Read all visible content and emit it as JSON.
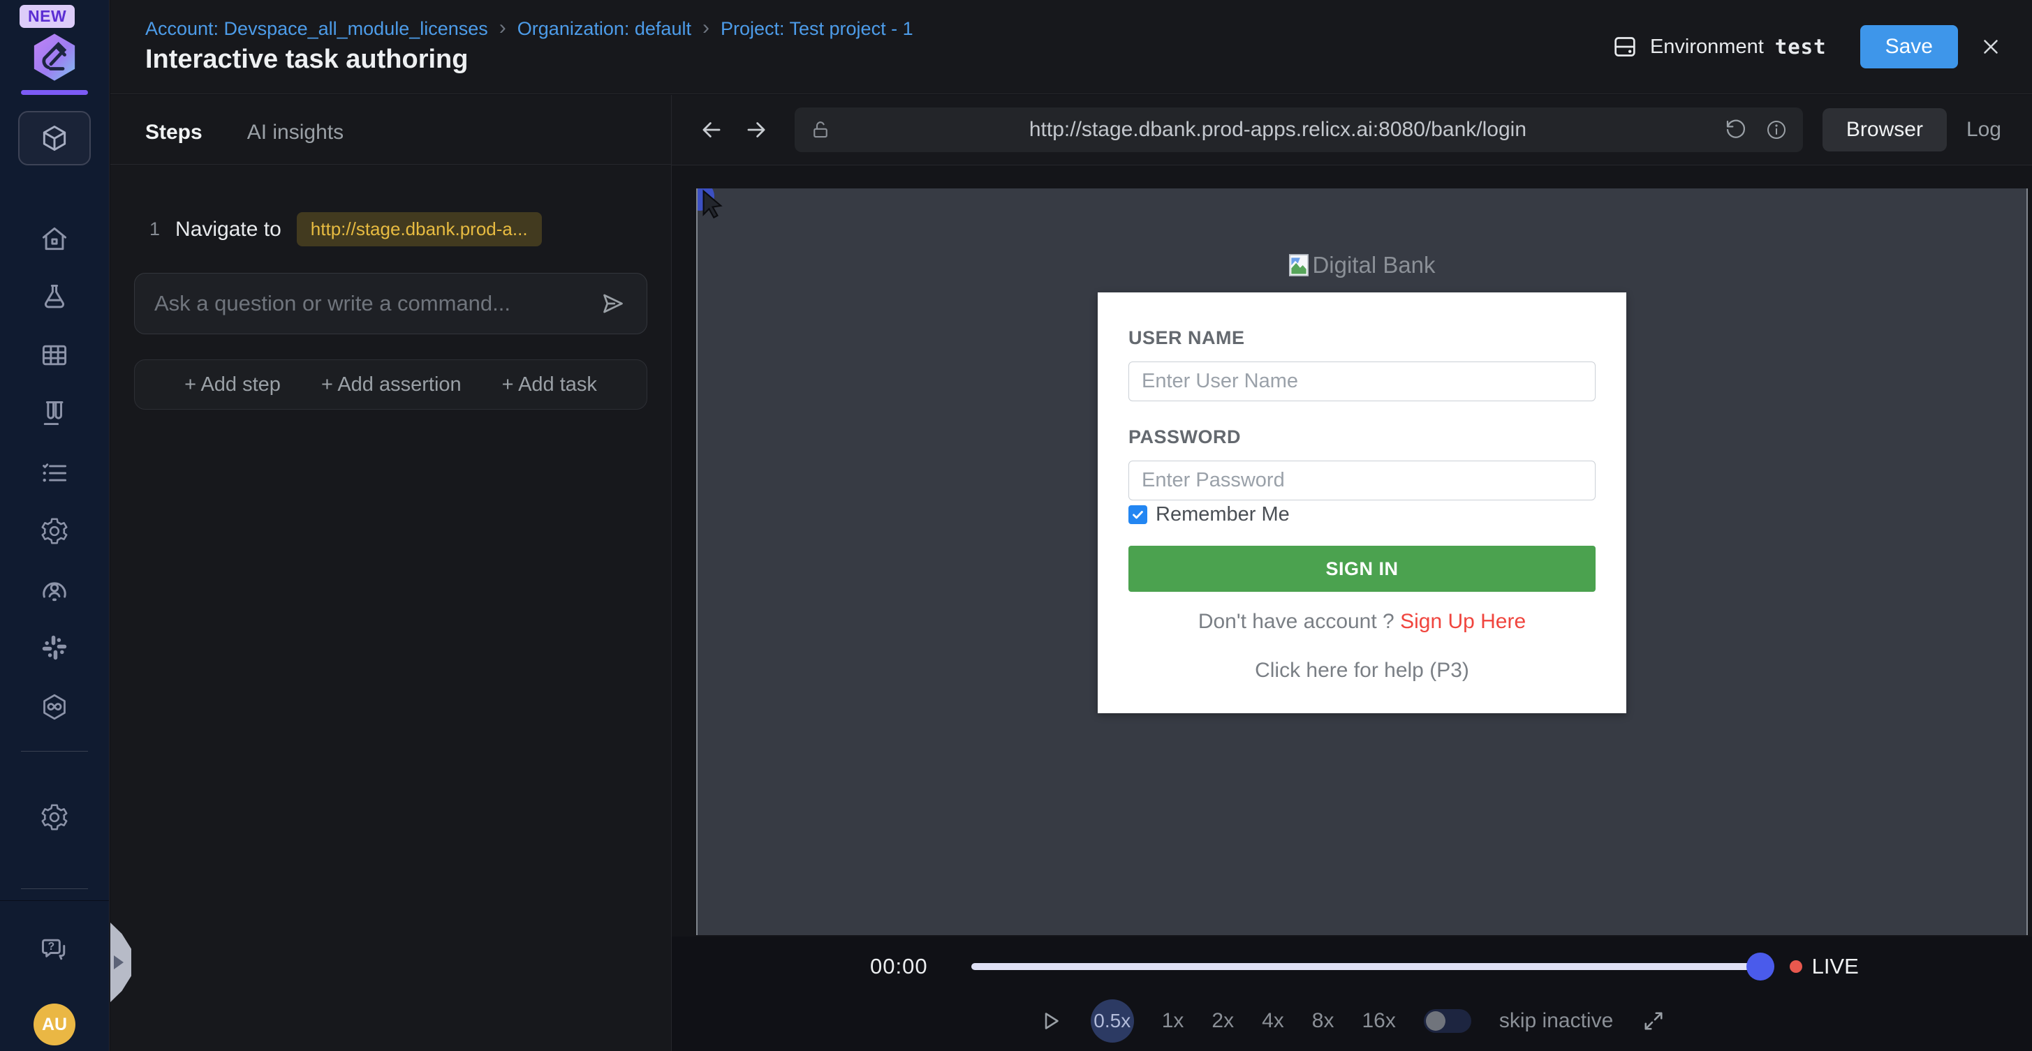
{
  "colors": {
    "accent_blue": "#3e96ea",
    "brand_purple": "#7c5bf5",
    "breadcrumb_link": "#4d9ce9",
    "step_target_yellow": "#e7bb41",
    "signin_green": "#4ba24f",
    "signup_red": "#f0453e",
    "live_red": "#e8584e",
    "player_thumb_blue": "#4a5beb",
    "avatar_gold": "#eab744"
  },
  "badge_new": "NEW",
  "breadcrumb": {
    "separator": "›",
    "items": [
      {
        "label": "Account: Devspace_all_module_licenses"
      },
      {
        "label": "Organization: default"
      },
      {
        "label": "Project: Test project - 1"
      }
    ]
  },
  "header": {
    "title": "Interactive task authoring",
    "environment_label": "Environment",
    "environment_value": "test",
    "save_label": "Save"
  },
  "sidebar": {
    "icons": [
      "package-icon",
      "home-icon",
      "flask-icon",
      "grid-icon",
      "test-tubes-icon",
      "checklist-icon",
      "gear-icon",
      "user-search-icon",
      "slack-icon",
      "hexagon-link-icon",
      "settings-icon",
      "help-chat-icon"
    ],
    "avatar_initials": "AU"
  },
  "steps_panel": {
    "tabs": [
      {
        "label": "Steps",
        "active": true
      },
      {
        "label": "AI insights",
        "active": false
      }
    ],
    "step": {
      "number": "1",
      "action": "Navigate to",
      "target": "http://stage.dbank.prod-a..."
    },
    "command_placeholder": "Ask a question or write a command...",
    "actions": [
      {
        "label": "+ Add step"
      },
      {
        "label": "+ Add assertion"
      },
      {
        "label": "+ Add task"
      }
    ]
  },
  "browser": {
    "url": "http://stage.dbank.prod-apps.relicx.ai:8080/bank/login",
    "tabs": [
      {
        "label": "Browser",
        "active": true
      },
      {
        "label": "Log",
        "active": false
      }
    ]
  },
  "login_page": {
    "logo_alt": "Digital Bank",
    "username_label": "USER NAME",
    "username_placeholder": "Enter User Name",
    "password_label": "PASSWORD",
    "password_placeholder": "Enter Password",
    "remember_label": "Remember Me",
    "signin_label": "SIGN IN",
    "signup_text": "Don't have account ?",
    "signup_link": "Sign Up Here",
    "help_text": "Click here for help (P3)"
  },
  "player": {
    "time": "00:00",
    "live_label": "LIVE",
    "speeds": [
      "0.5x",
      "1x",
      "2x",
      "4x",
      "8x",
      "16x"
    ],
    "active_speed": "0.5x",
    "skip_label": "skip inactive"
  }
}
